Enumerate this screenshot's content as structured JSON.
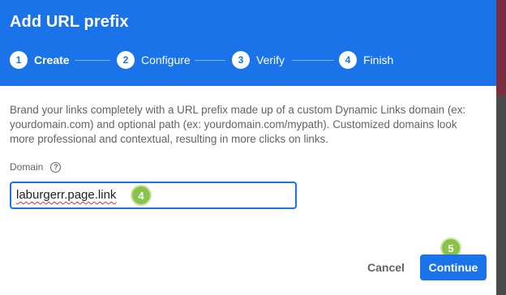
{
  "dialog": {
    "title": "Add URL prefix",
    "steps": [
      {
        "number": "1",
        "label": "Create"
      },
      {
        "number": "2",
        "label": "Configure"
      },
      {
        "number": "3",
        "label": "Verify"
      },
      {
        "number": "4",
        "label": "Finish"
      }
    ],
    "active_step": 0,
    "description": "Brand your links completely with a URL prefix made up of a custom Dynamic Links domain (ex: yourdomain.com) and optional path (ex: yourdomain.com/mypath). Customized domains look more professional and contextual, resulting in more clicks on links.",
    "domain_field": {
      "label": "Domain",
      "help_icon": "help-circle-icon",
      "value": "laburgerr.page.link"
    },
    "markers": {
      "input_marker": "4",
      "continue_marker": "5"
    },
    "buttons": {
      "cancel": "Cancel",
      "continue": "Continue"
    }
  },
  "colors": {
    "header": "#1a73e8",
    "primary_button": "#1a73e8",
    "marker": "#8bc34a",
    "spellcheck_underline": "#d93025"
  }
}
